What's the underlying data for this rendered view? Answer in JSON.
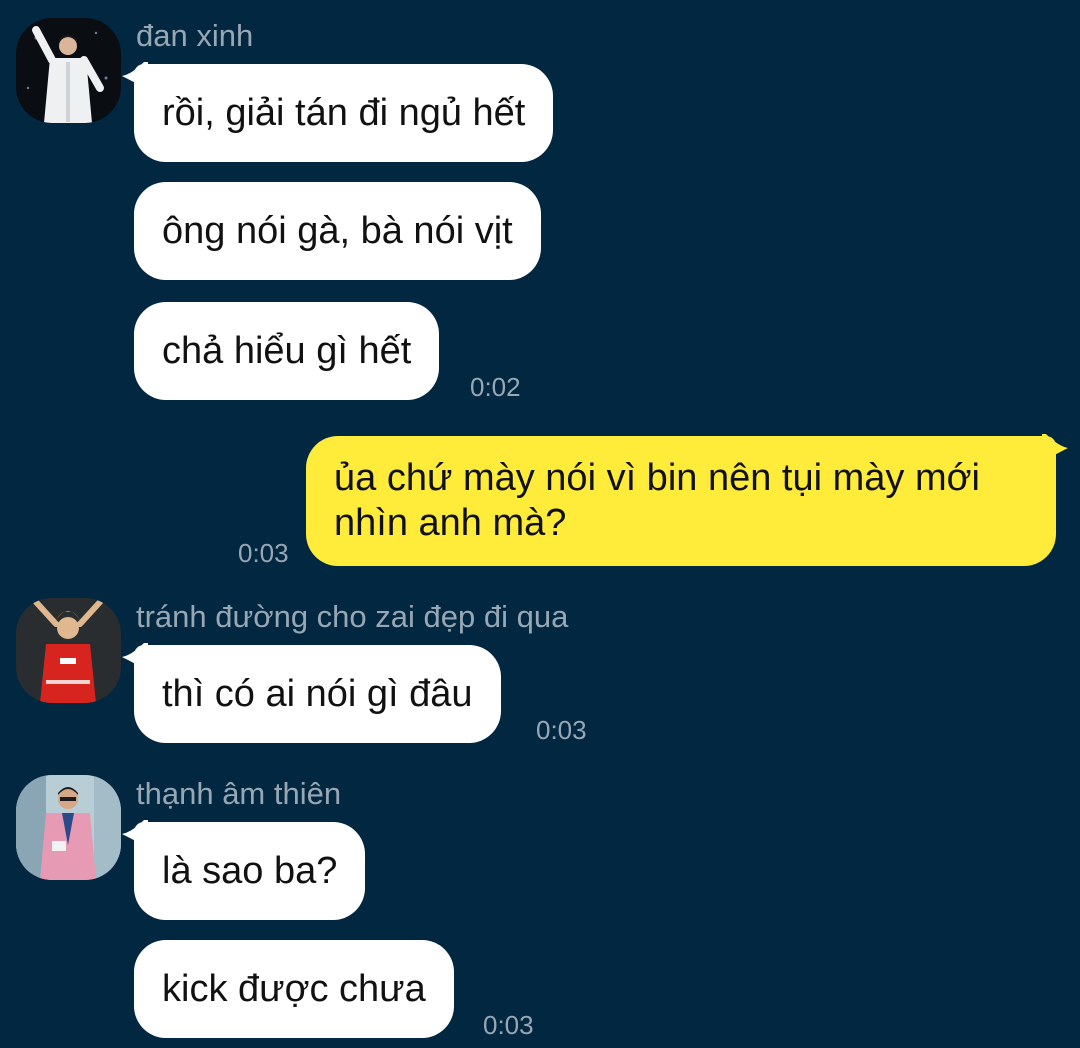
{
  "colors": {
    "background": "#022741",
    "incoming_bubble": "#ffffff",
    "outgoing_bubble": "#ffeb3a",
    "meta_text": "#98a7b4"
  },
  "messages": [
    {
      "sender": "đan xinh",
      "avatar": "performer-white-suit-avatar",
      "bubbles": [
        "rồi, giải tán đi ngủ hết",
        "ông nói gà, bà nói vịt",
        "chả hiểu gì hết"
      ],
      "time": "0:02"
    },
    {
      "outgoing": true,
      "text": "ủa chứ mày nói vì bin nên tụi mày mới nhìn anh mà?",
      "time": "0:03"
    },
    {
      "sender": "tránh đường cho zai đẹp đi qua",
      "avatar": "performer-red-jersey-avatar",
      "bubbles": [
        "thì có ai nói gì đâu"
      ],
      "time": "0:03"
    },
    {
      "sender": "thạnh âm thiên",
      "avatar": "performer-pink-suit-avatar",
      "bubbles": [
        "là sao ba?",
        "kick được chưa"
      ],
      "time": "0:03"
    }
  ]
}
